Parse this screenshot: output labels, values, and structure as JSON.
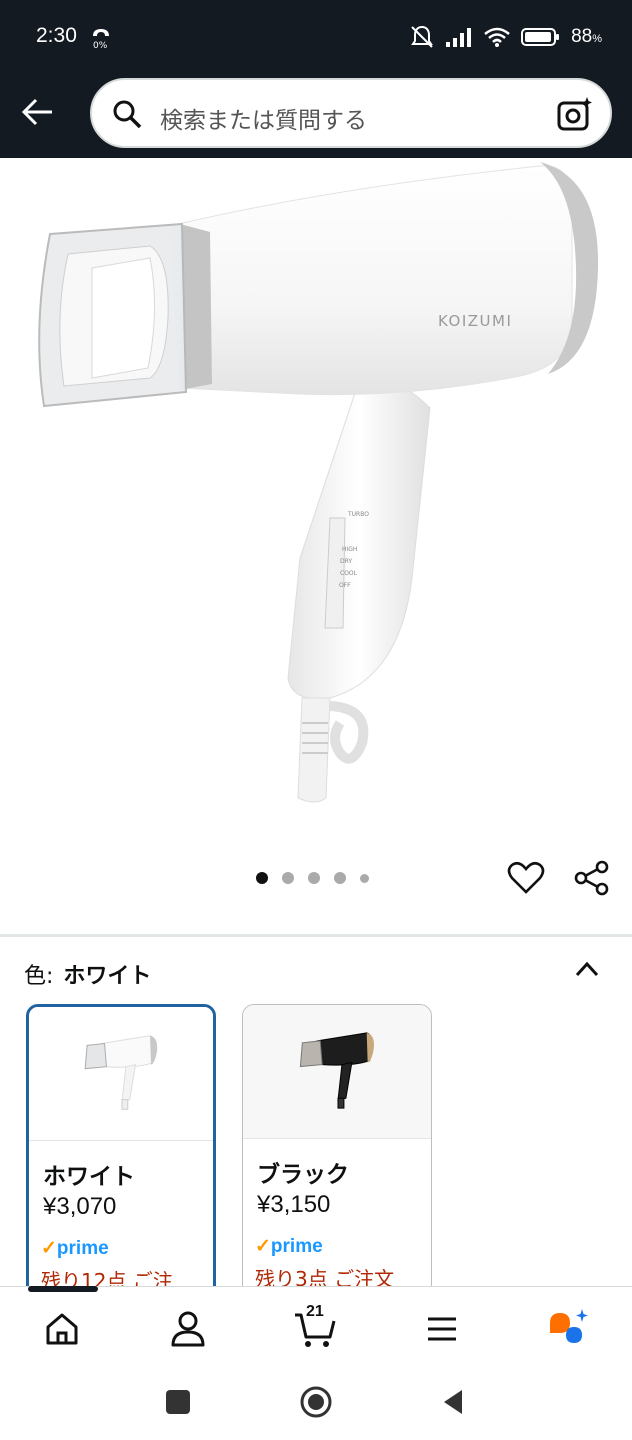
{
  "status_bar": {
    "time": "2:30",
    "data_speed": "0%",
    "battery": "88",
    "battery_unit": "%"
  },
  "search": {
    "placeholder": "検索または質問する"
  },
  "carousel": {
    "total": 5,
    "active_index": 0
  },
  "color_selector": {
    "label": "色:",
    "selected": "ホワイト"
  },
  "variants": [
    {
      "name": "ホワイト",
      "price": "¥3,070",
      "prime": "prime",
      "stock": "残り12点 ご注",
      "selected": true
    },
    {
      "name": "ブラック",
      "price": "¥3,150",
      "prime": "prime",
      "stock": "残り3点 ご注文",
      "selected": false
    }
  ],
  "bottom_nav": {
    "cart_count": "21"
  },
  "colors": {
    "header_bg": "#131a22",
    "selected_border": "#2162a1",
    "prime_blue": "#1a98ff",
    "stock_red": "#b12704",
    "accent_orange": "#ff6f00"
  }
}
